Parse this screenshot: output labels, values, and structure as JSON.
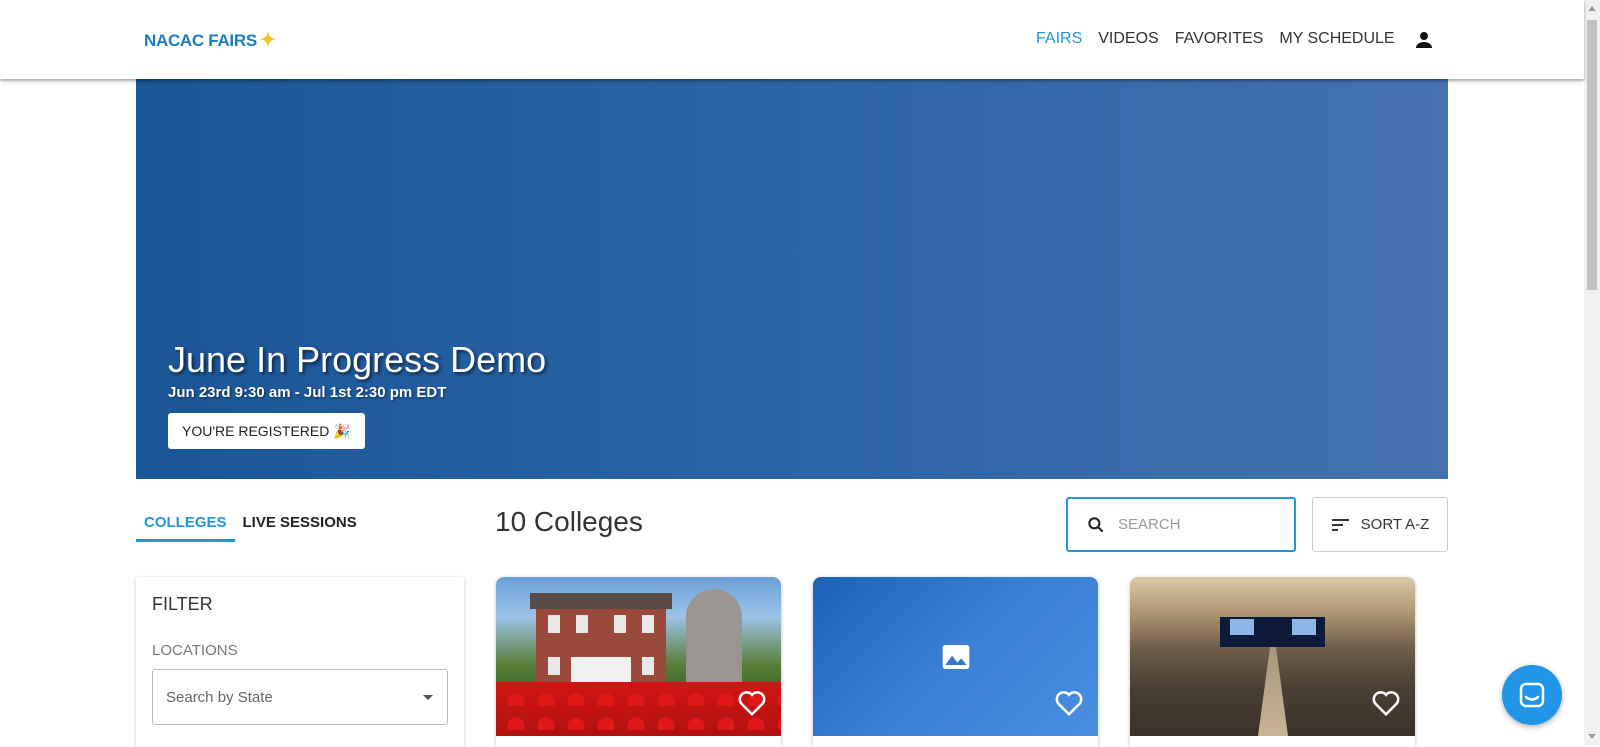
{
  "header": {
    "logo_text": "NACAC FAIRS",
    "logo_icon": "star-icon",
    "nav": [
      {
        "label": "FAIRS",
        "active": true
      },
      {
        "label": "VIDEOS",
        "active": false
      },
      {
        "label": "FAVORITES",
        "active": false
      },
      {
        "label": "MY SCHEDULE",
        "active": false
      }
    ],
    "user_icon": "user-icon"
  },
  "hero": {
    "title": "June In Progress Demo",
    "date_range": "Jun 23rd 9:30 am - Jul 1st 2:30 pm EDT",
    "registered_label": "YOU'RE REGISTERED",
    "registered_icon": "party-popper-icon"
  },
  "tabs": [
    {
      "label": "COLLEGES",
      "active": true
    },
    {
      "label": "LIVE SESSIONS",
      "active": false
    }
  ],
  "results": {
    "count_label": "10 Colleges"
  },
  "search": {
    "placeholder": "SEARCH"
  },
  "sort": {
    "label": "SORT A-Z"
  },
  "filter": {
    "title": "FILTER",
    "locations_label": "LOCATIONS",
    "state_placeholder": "Search by State"
  },
  "cards": [
    {
      "image": "campus-building-lion-statue",
      "favorited": false
    },
    {
      "image": "placeholder-image-icon",
      "favorited": false
    },
    {
      "image": "conference-hall",
      "favorited": false
    }
  ],
  "colors": {
    "accent": "#2196d9",
    "hero_start": "#1a5596",
    "hero_end": "#4671b0",
    "chat": "#2196e8"
  }
}
